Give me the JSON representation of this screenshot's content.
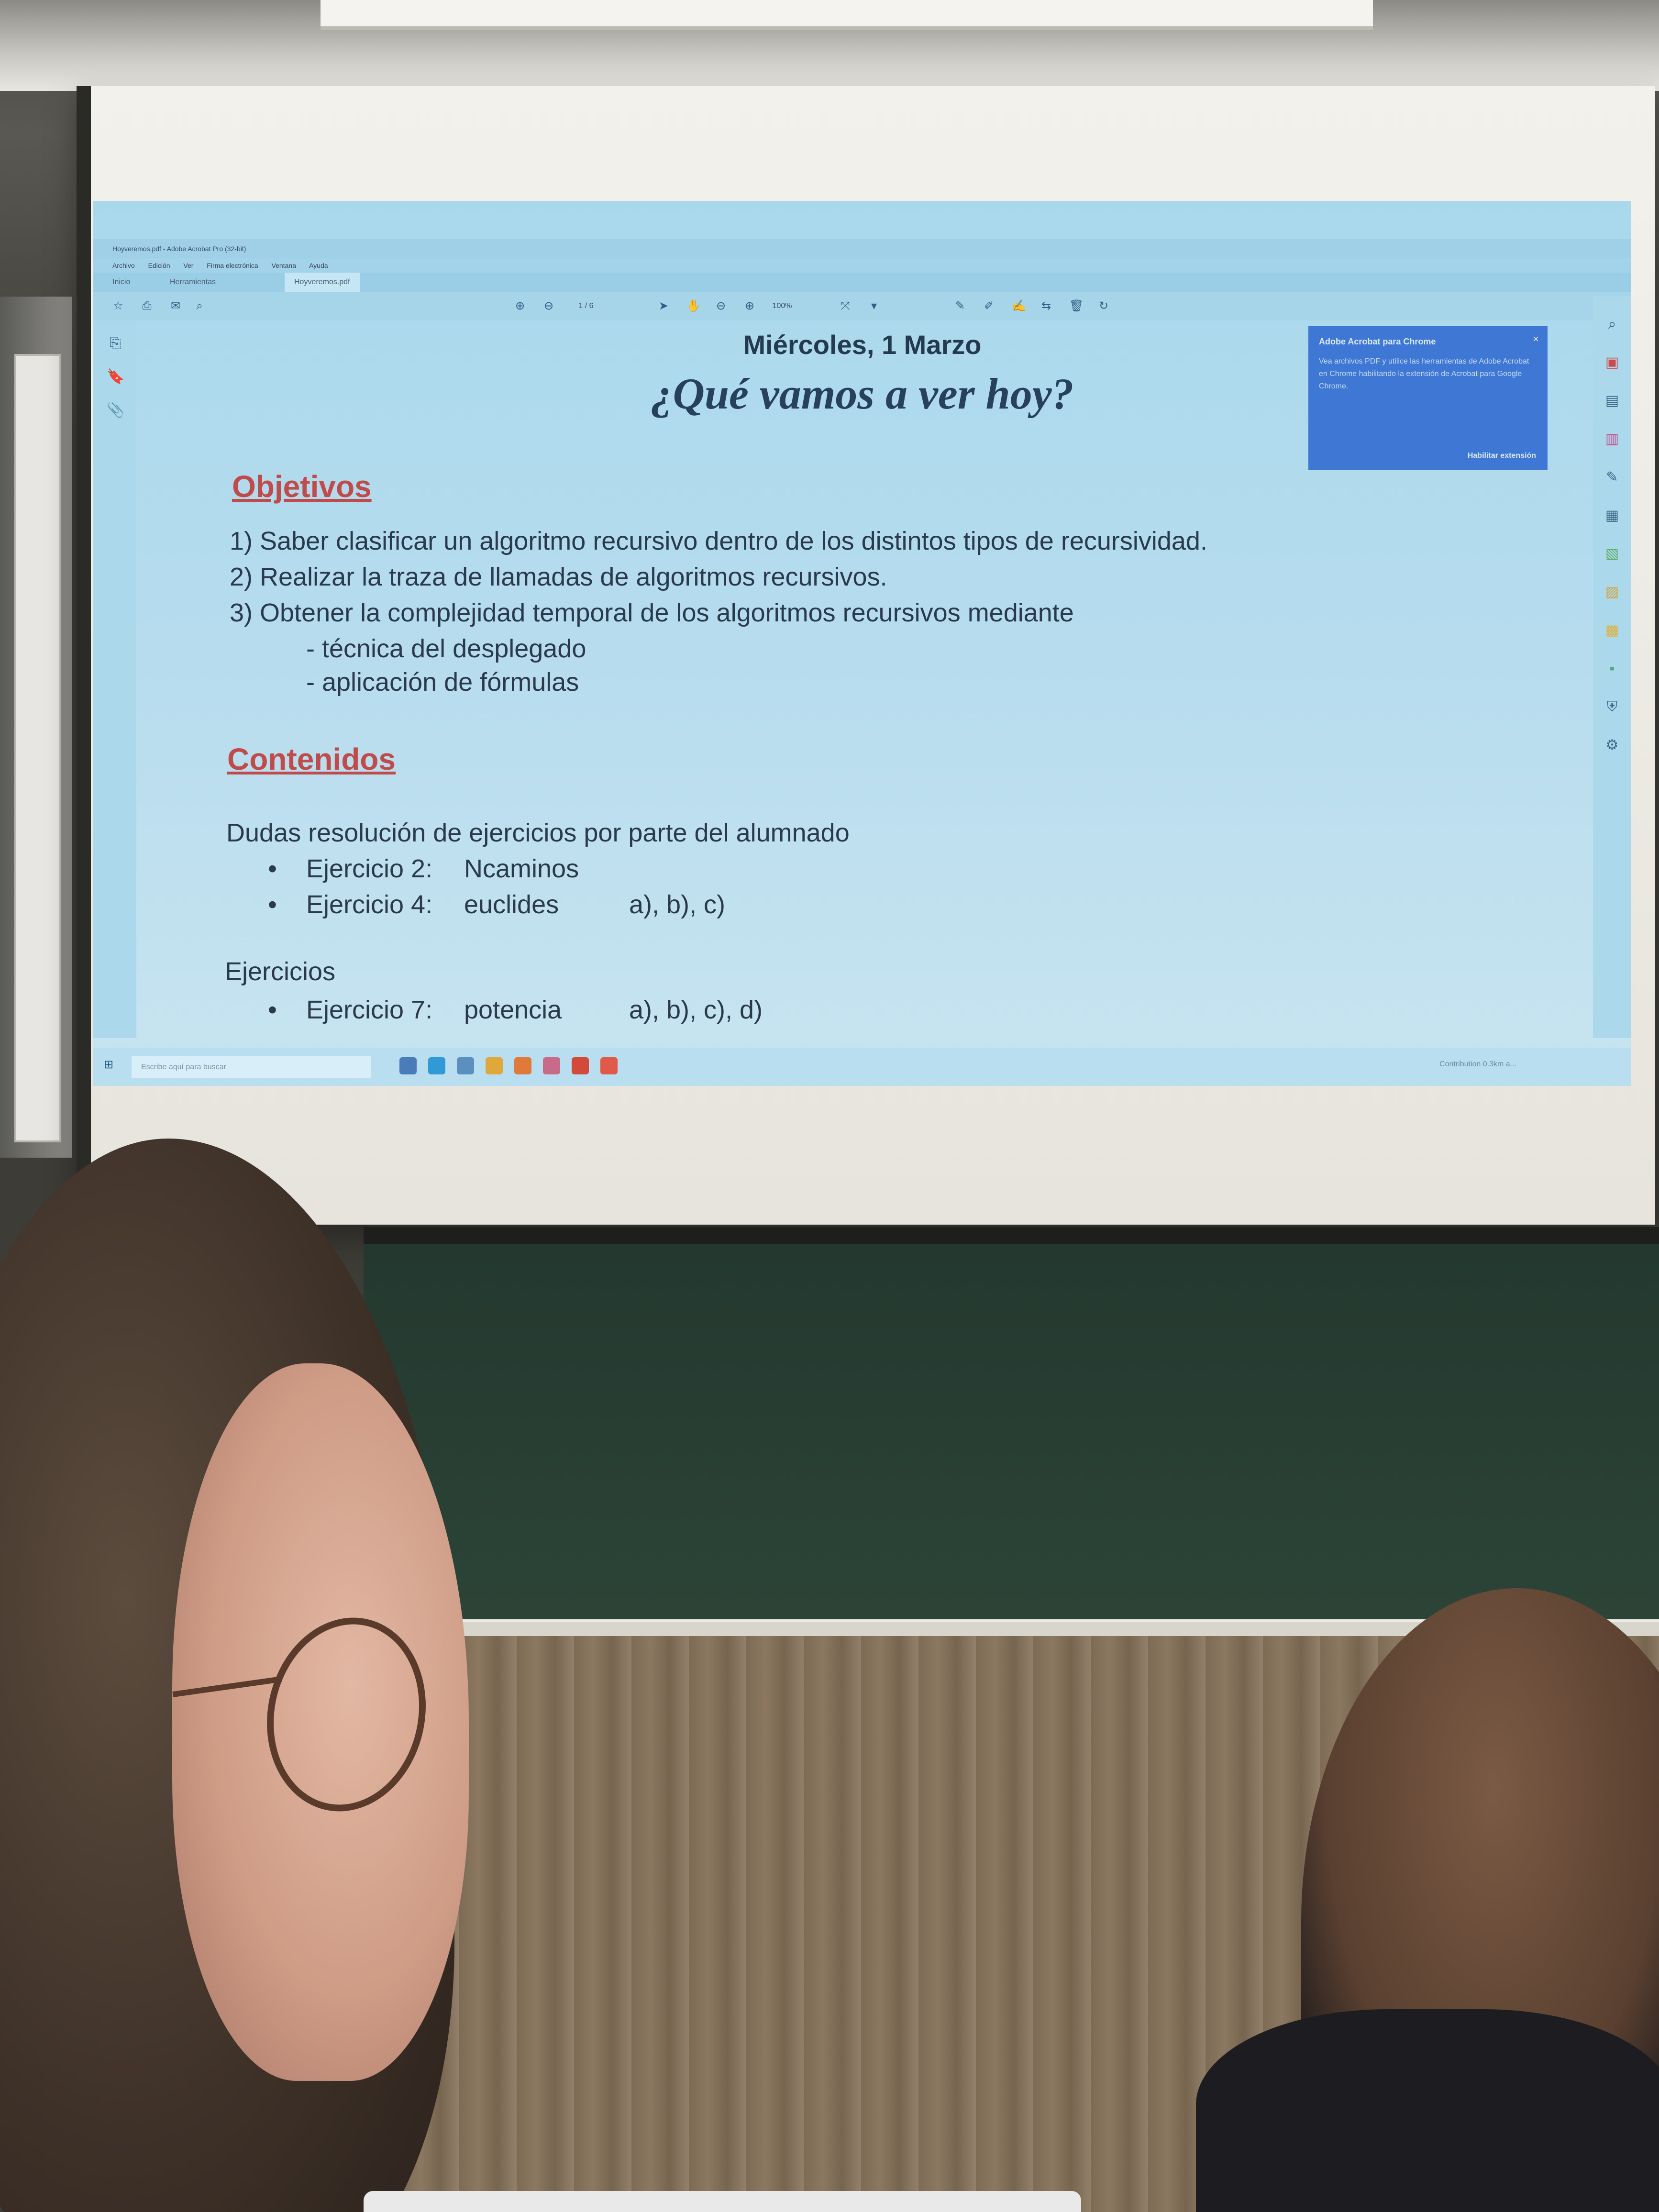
{
  "slide": {
    "window_title": "Hoyveremos.pdf - Adobe Acrobat Pro (32-bit)",
    "menu": [
      "Archivo",
      "Edición",
      "Ver",
      "Firma electrónica",
      "Ventana",
      "Ayuda"
    ],
    "tabs": [
      "Inicio",
      "Herramientas",
      "Hoyveremos.pdf"
    ],
    "page_indicator": "1 / 6",
    "zoom": "100%",
    "date": "Miércoles, 1 Marzo",
    "title": "¿Qué vamos a ver hoy?",
    "objetivos": {
      "heading": "Objetivos",
      "items": [
        "1) Saber clasificar un algoritmo recursivo dentro de los distintos tipos de recursividad.",
        "2) Realizar la traza de llamadas de algoritmos recursivos.",
        "3) Obtener la complejidad temporal de los algoritmos recursivos mediante"
      ],
      "subitems": [
        "- técnica del desplegado",
        "- aplicación de fórmulas"
      ]
    },
    "contenidos": {
      "heading": "Contenidos",
      "intro": "Dudas resolución de ejercicios por parte del alumnado",
      "dudas": [
        {
          "label": "Ejercicio 2:",
          "name": "Ncaminos",
          "parts": ""
        },
        {
          "label": "Ejercicio 4:",
          "name": "euclides",
          "parts": "a), b), c)"
        }
      ],
      "ejercicios_heading": "Ejercicios",
      "ejercicios": [
        {
          "label": "Ejercicio 7:",
          "name": "potencia",
          "parts": "a), b), c), d)"
        }
      ]
    },
    "popup": {
      "title": "Adobe Acrobat para Chrome",
      "body": "Vea archivos PDF y utilice las herramientas de Adobe Acrobat en Chrome habilitando la extensión de Acrobat para Google Chrome.",
      "button": "Habilitar extensión"
    },
    "taskbar": {
      "search_placeholder": "Escribe aquí para buscar",
      "tray": "Contribution 0.3km a..."
    }
  },
  "colors": {
    "slide_bg": "#b6dcee",
    "heading": "#c14a4a",
    "text": "#2a3a4c",
    "popup": "#3f78d4"
  }
}
